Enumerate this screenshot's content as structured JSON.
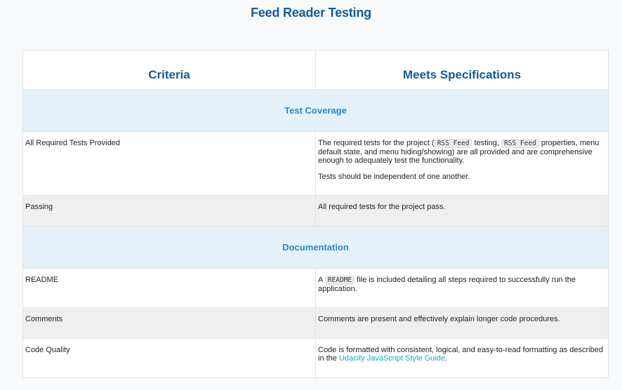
{
  "page_title": "Feed Reader Testing",
  "table": {
    "header": {
      "criteria": "Criteria",
      "meets": "Meets Specifications"
    },
    "sections": [
      {
        "title": "Test Coverage",
        "rows": [
          {
            "criteria": "All Required Tests Provided",
            "meets_p1_a": "The required tests for the project (",
            "meets_p1_code1": "RSS Feed",
            "meets_p1_b": " testing, ",
            "meets_p1_code2": "RSS Feed",
            "meets_p1_c": " properties, menu default state, and menu hiding/showing) are all provided and are comprehensive enough to adequately test the functionality.",
            "meets_p2": "Tests should be independent of one another."
          },
          {
            "criteria": "Passing",
            "meets": "All required tests for the project pass."
          }
        ]
      },
      {
        "title": "Documentation",
        "rows": [
          {
            "criteria": "README",
            "meets_a": "A ",
            "meets_code": "README",
            "meets_b": " file is included detailing all steps required to successfully run the application."
          },
          {
            "criteria": "Comments",
            "meets": "Comments are present and effectively explain longer code procedures."
          },
          {
            "criteria": "Code Quality",
            "meets_a": "Code is formatted with consistent, logical, and easy-to-read formatting as described in the ",
            "meets_link": "Udacity JavaScript Style Guide",
            "meets_b": "."
          }
        ]
      }
    ]
  },
  "colors": {
    "heading": "#165a94",
    "section_bg": "#e4f1f9",
    "section_text": "#2c88c6",
    "link": "#15a8d0",
    "shaded_row": "#efefef"
  }
}
